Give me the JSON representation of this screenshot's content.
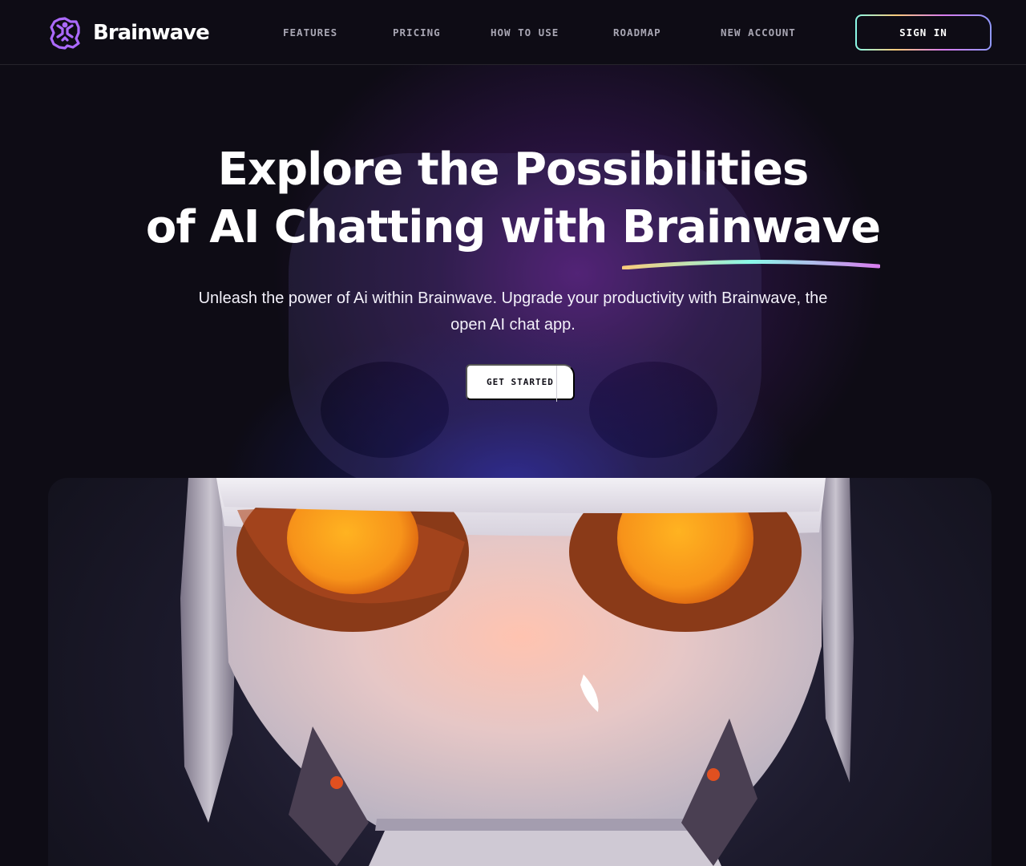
{
  "brand": {
    "name": "Brainwave",
    "logo_icon": "brain-network-icon",
    "accent_color": "#ac6aff"
  },
  "nav": {
    "items": [
      {
        "label": "FEATURES"
      },
      {
        "label": "PRICING"
      },
      {
        "label": "HOW TO USE"
      },
      {
        "label": "ROADMAP"
      },
      {
        "label": "NEW ACCOUNT"
      }
    ],
    "signin_label": "SIGN IN"
  },
  "hero": {
    "title_line1": "Explore the Possibilities",
    "title_line2_prefix": "of AI Chatting with ",
    "title_highlight": "Brainwave",
    "subtitle": "Unleash the power of Ai within Brainwave. Upgrade your productivity with Brainwave, the open AI chat app.",
    "cta_label": "GET STARTED"
  },
  "colors": {
    "background": "#0e0c15",
    "nav_text": "#a8a6b3",
    "robot_eye": "#f7a21a",
    "underline_gradient": [
      "#facb7b",
      "#89f9e8",
      "#d87cee"
    ]
  },
  "media": {
    "hero_image_icon": "robot-head-image"
  }
}
